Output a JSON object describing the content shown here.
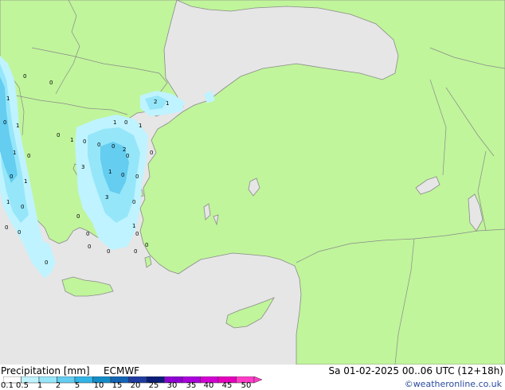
{
  "footer": {
    "title": "Precipitation [mm]",
    "model": "ECMWF",
    "datetime": "Sa 01-02-2025 00..06 UTC (12+18h)",
    "credit": "©weatheronline.co.uk"
  },
  "legend": {
    "ticks": [
      "0.1",
      "0.5",
      "1",
      "2",
      "5",
      "10",
      "15",
      "20",
      "25",
      "30",
      "35",
      "40",
      "45",
      "50"
    ],
    "colors": [
      "#ffffff",
      "#bff3ff",
      "#96e6fa",
      "#64cdf0",
      "#32b4e6",
      "#148cc8",
      "#1464b4",
      "#1e3ca0",
      "#0a1e78",
      "#8c00d2",
      "#aa00dc",
      "#d200d2",
      "#e600be",
      "#ff3cc8"
    ]
  },
  "map": {
    "colors": {
      "sea": "#e6e6e6",
      "land": "#c0f59b",
      "border": "#8a8a8a",
      "precip_light": "#bff3ff",
      "precip_medium": "#96e6fa",
      "precip_strong": "#64cdf0"
    },
    "labels": [
      "0",
      "0",
      "1",
      "0",
      "1",
      "0",
      "1",
      "0",
      "0",
      "0",
      "1",
      "0",
      "1",
      "2",
      "1",
      "0",
      "1",
      "0",
      "2",
      "0",
      "1",
      "3",
      "0",
      "0",
      "0",
      "1",
      "1",
      "0",
      "3",
      "0",
      "0",
      "1",
      "0",
      "0",
      "0",
      "0",
      "0",
      "0",
      "0",
      "0",
      "0"
    ]
  }
}
